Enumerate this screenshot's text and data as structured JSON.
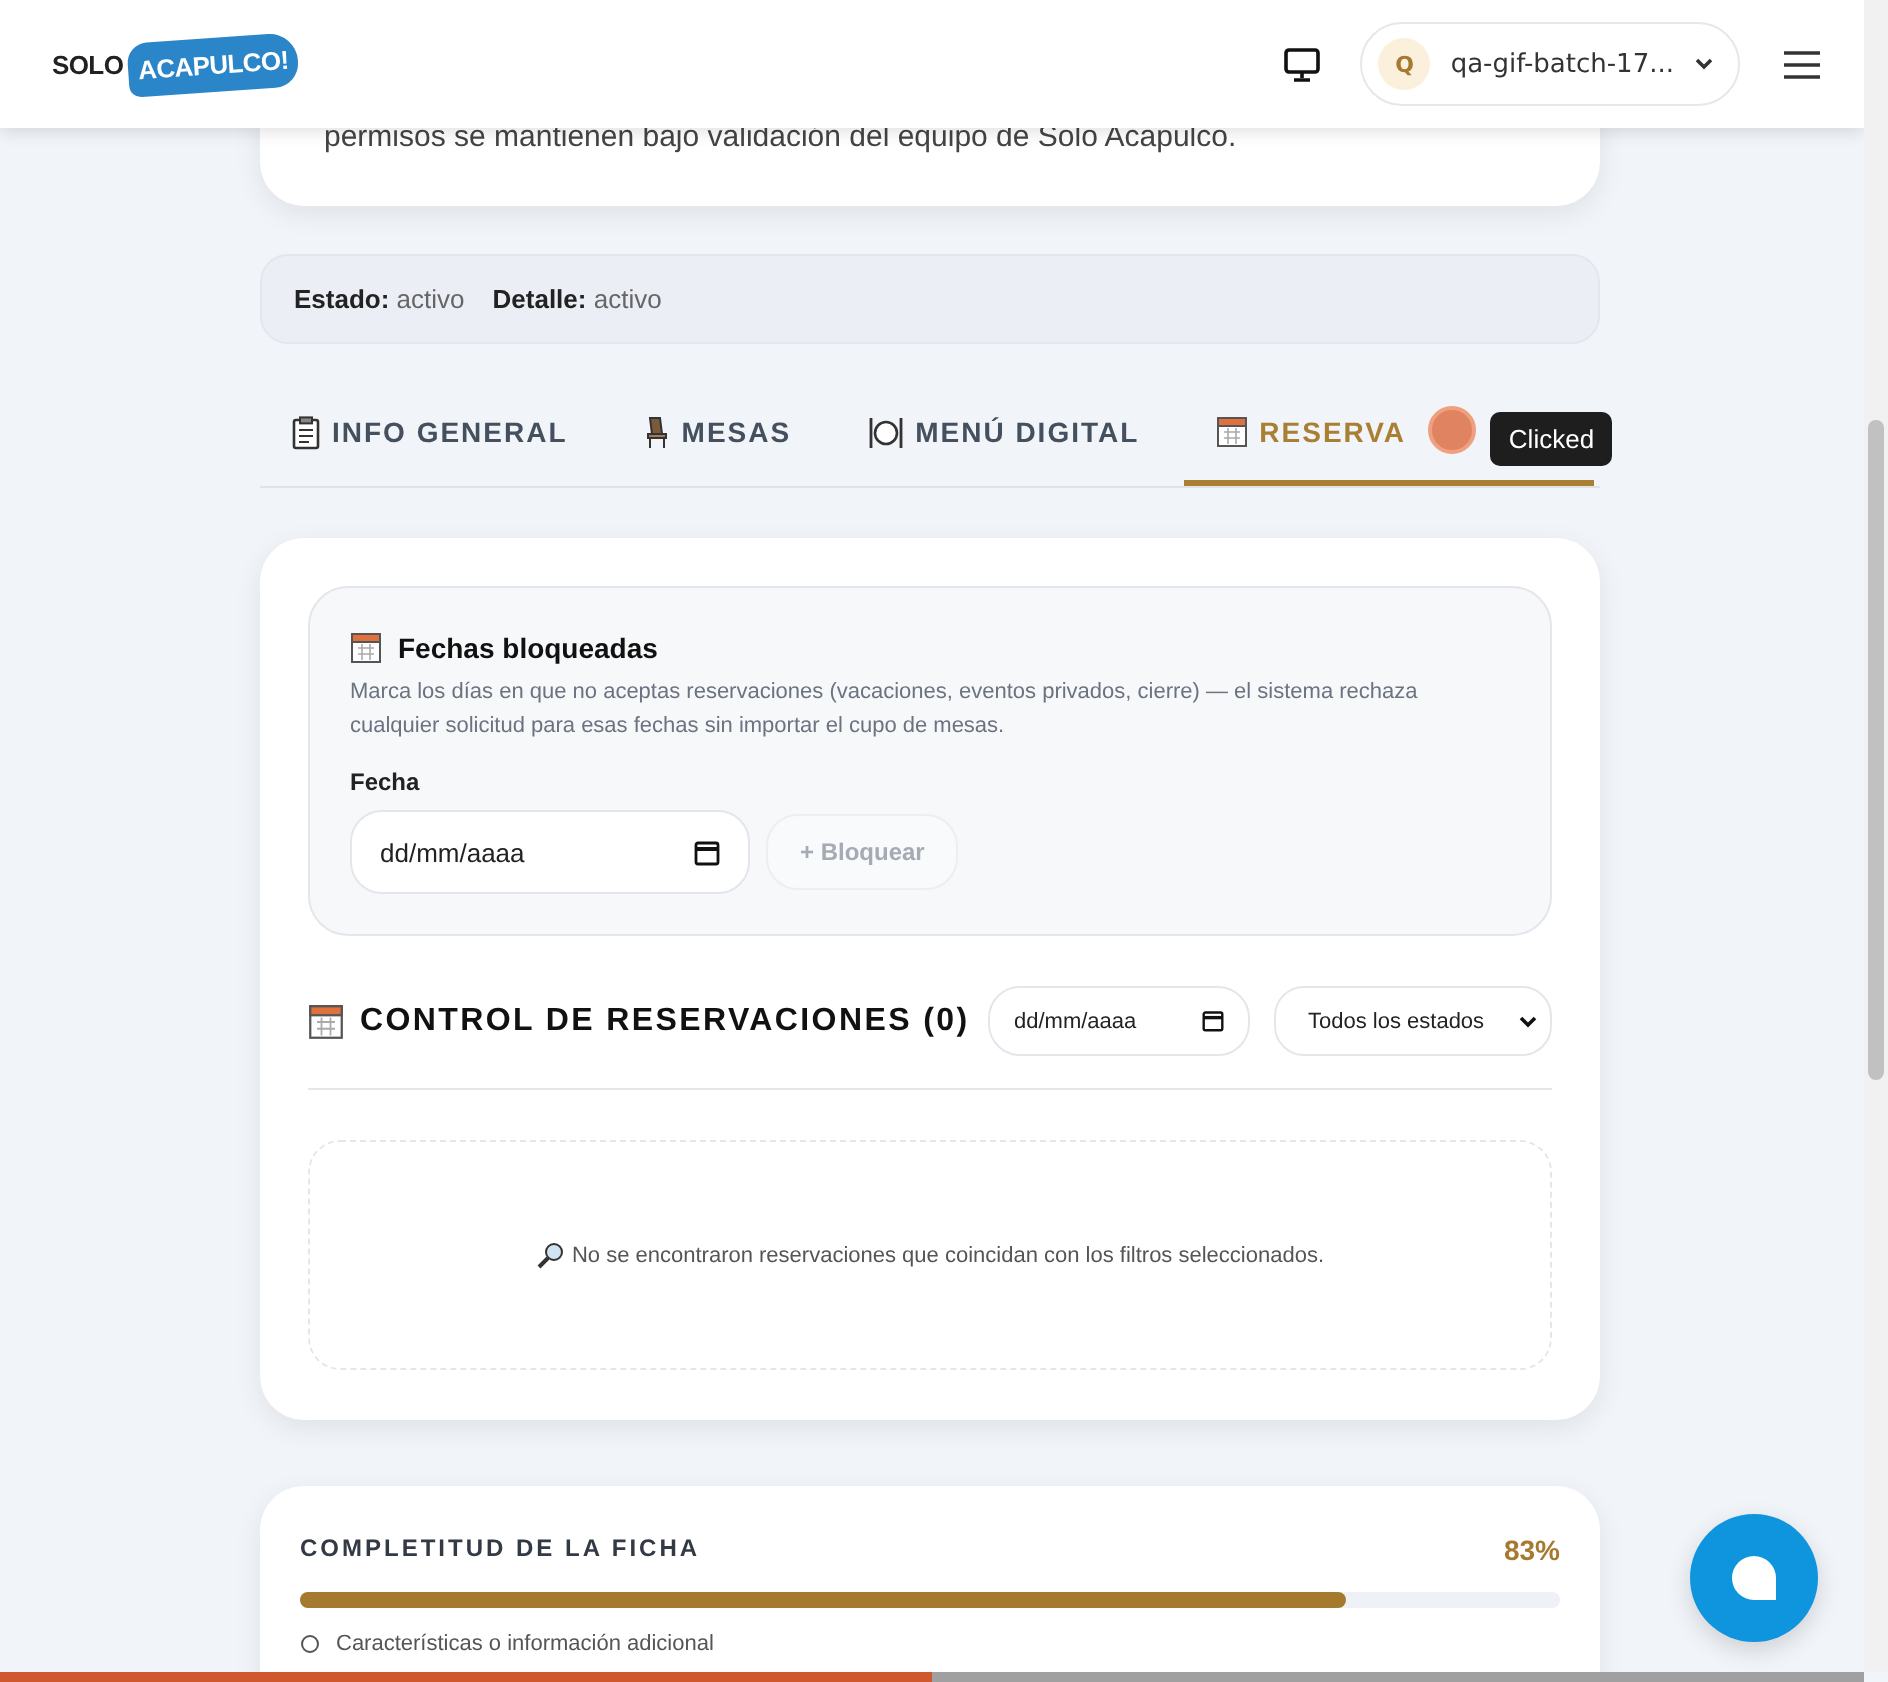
{
  "header": {
    "logo": {
      "word_1": "SOLO",
      "word_2": "ACAPULCO!"
    },
    "account": {
      "initial": "Q",
      "name": "qa-gif-batch-17..."
    }
  },
  "intro_card": {
    "text": "permisos se mantienen bajo validación del equipo de Solo Acapulco."
  },
  "status_bar": [
    {
      "label": "Estado:",
      "value": "activo"
    },
    {
      "label": "Detalle:",
      "value": "activo"
    }
  ],
  "tabs": [
    {
      "label": "INFO GENERAL",
      "kind": "clipboard",
      "selected": false
    },
    {
      "label": "MESAS",
      "kind": "chair",
      "selected": false
    },
    {
      "label": "MENÚ DIGITAL",
      "kind": "plate",
      "selected": false
    },
    {
      "label": "RESERVA",
      "kind": "calendar",
      "selected": true
    }
  ],
  "click_tooltip": "Clicked",
  "blocked_dates": {
    "title": "Fechas bloqueadas",
    "description": "Marca los días en que no aceptas reservaciones (vacaciones, eventos privados, cierre) — el sistema rechaza cualquier solicitud para esas fechas sin importar el cupo de mesas.",
    "field_label": "Fecha",
    "date_placeholder": "dd/mm/aaaa",
    "button": "+ Bloquear",
    "button_disabled": true
  },
  "reservations": {
    "title": "CONTROL DE RESERVACIONES (0)",
    "date_filter": "dd/mm/aaaa",
    "status_filter": "Todos los estados",
    "empty_message": "No se encontraron reservaciones que coincidan con los filtros seleccionados."
  },
  "completeness": {
    "title": "COMPLETITUD DE LA FICHA",
    "percent": "83%",
    "level": 0.83,
    "items": [
      {
        "label": "Características o información adicional",
        "done": false
      }
    ]
  },
  "page_progress": {
    "level": 0.5
  }
}
